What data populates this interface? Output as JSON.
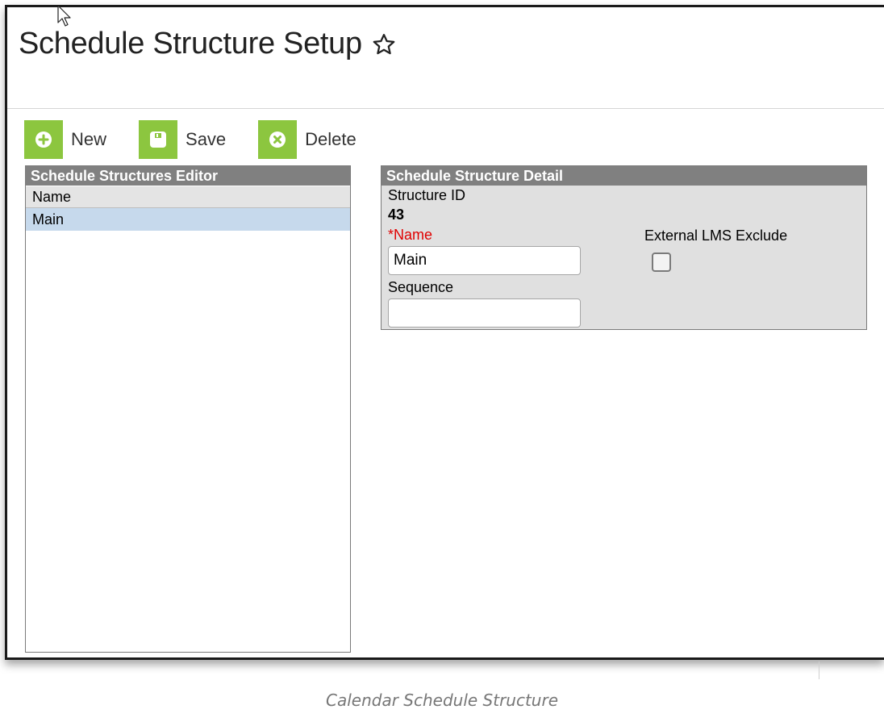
{
  "header": {
    "title": "Schedule Structure Setup"
  },
  "toolbar": {
    "new_label": "New",
    "save_label": "Save",
    "delete_label": "Delete"
  },
  "editor": {
    "title": "Schedule Structures Editor",
    "column": "Name",
    "rows": [
      {
        "name": "Main",
        "selected": true
      }
    ]
  },
  "detail": {
    "title": "Schedule Structure Detail",
    "structure_id_label": "Structure ID",
    "structure_id_value": "43",
    "name_required_marker": "*",
    "name_label": "Name",
    "name_value": "Main",
    "sequence_label": "Sequence",
    "sequence_value": "",
    "lms_label": "External LMS Exclude",
    "lms_checked": false
  },
  "caption": "Calendar Schedule Structure",
  "colors": {
    "accent_green": "#8cc63f",
    "panel_header": "#808080",
    "selected_row": "#c6d9ec",
    "required_red": "#e00000"
  }
}
